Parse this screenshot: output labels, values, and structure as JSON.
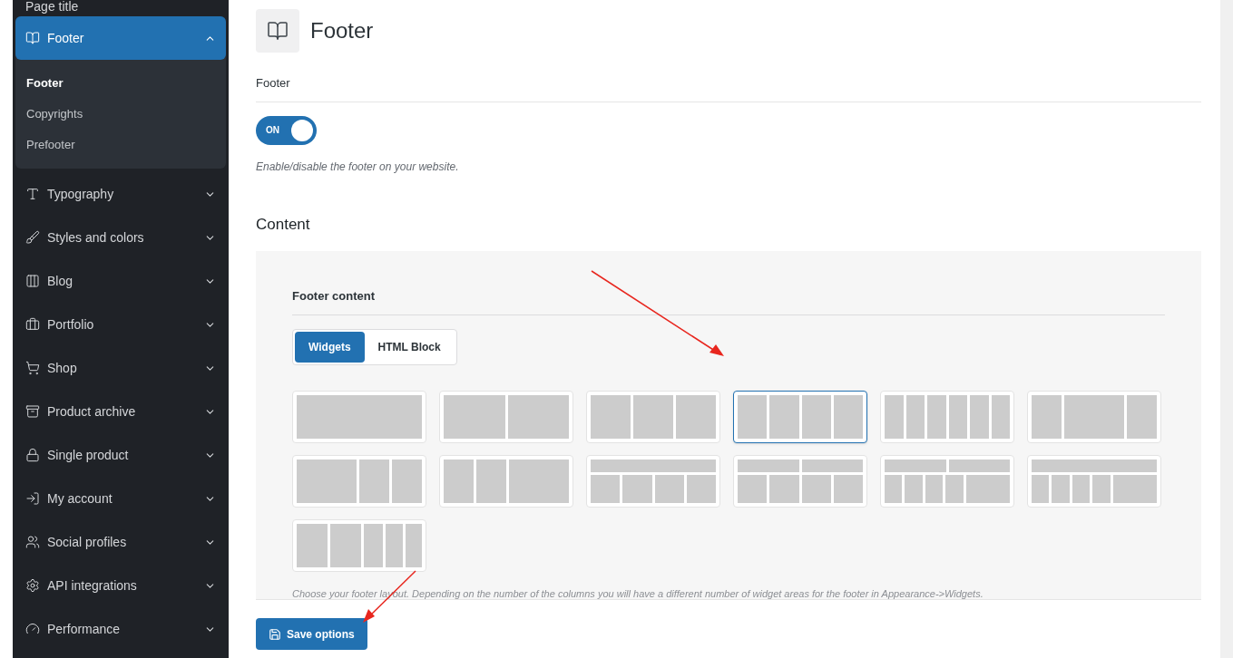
{
  "sidebar": {
    "items": [
      {
        "label": "Page title",
        "expanded": false,
        "selected": false
      },
      {
        "label": "Footer",
        "expanded": true,
        "selected": true,
        "children": [
          {
            "label": "Footer",
            "selected": true
          },
          {
            "label": "Copyrights",
            "selected": false
          },
          {
            "label": "Prefooter",
            "selected": false
          }
        ]
      },
      {
        "label": "Typography",
        "expanded": false,
        "selected": false
      },
      {
        "label": "Styles and colors",
        "expanded": false,
        "selected": false
      },
      {
        "label": "Blog",
        "expanded": false,
        "selected": false
      },
      {
        "label": "Portfolio",
        "expanded": false,
        "selected": false
      },
      {
        "label": "Shop",
        "expanded": false,
        "selected": false
      },
      {
        "label": "Product archive",
        "expanded": false,
        "selected": false
      },
      {
        "label": "Single product",
        "expanded": false,
        "selected": false
      },
      {
        "label": "My account",
        "expanded": false,
        "selected": false
      },
      {
        "label": "Social profiles",
        "expanded": false,
        "selected": false
      },
      {
        "label": "API integrations",
        "expanded": false,
        "selected": false
      },
      {
        "label": "Performance",
        "expanded": false,
        "selected": false
      }
    ]
  },
  "page": {
    "title": "Footer"
  },
  "footer_setting": {
    "label": "Footer",
    "toggle_text": "ON",
    "on": true,
    "description": "Enable/disable the footer on your website."
  },
  "content": {
    "heading": "Content",
    "panel": {
      "label": "Footer content",
      "tabs": [
        {
          "label": "Widgets",
          "selected": true
        },
        {
          "label": "HTML Block",
          "selected": false
        }
      ],
      "layouts": [
        {
          "selected": false
        },
        {
          "selected": false
        },
        {
          "selected": false
        },
        {
          "selected": true
        },
        {
          "selected": false
        },
        {
          "selected": false
        },
        {
          "selected": false
        },
        {
          "selected": false
        },
        {
          "selected": false
        },
        {
          "selected": false
        },
        {
          "selected": false
        },
        {
          "selected": false
        },
        {
          "selected": false
        }
      ],
      "help": "Choose your footer layout. Depending on the number of the columns you will have a different number of widget areas for the footer in Appearance->Widgets."
    }
  },
  "save_button": "Save options"
}
